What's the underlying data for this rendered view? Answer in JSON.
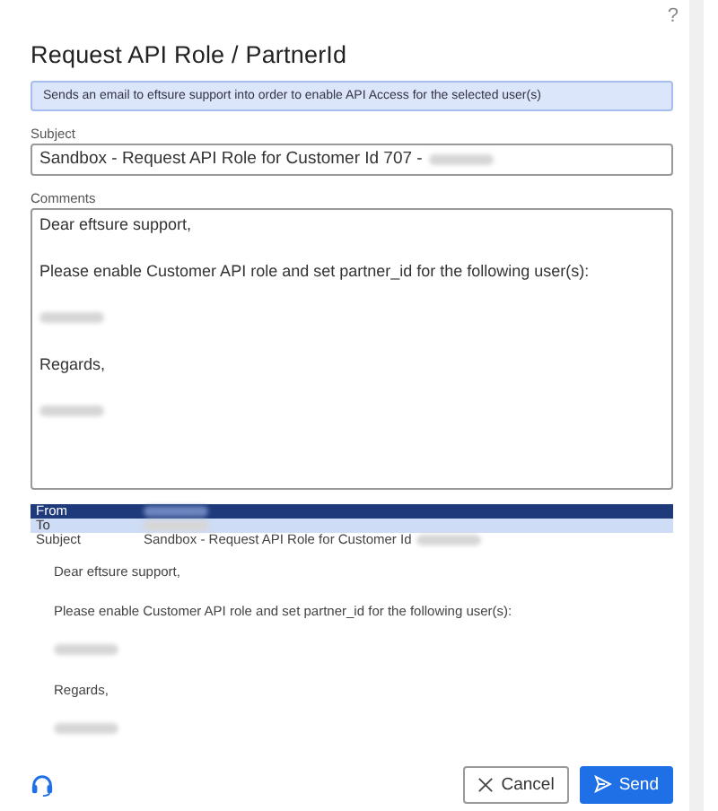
{
  "help": "?",
  "title": "Request API Role / PartnerId",
  "info": "Sends an email to eftsure support into order to enable API Access for the selected user(s)",
  "subject": {
    "label": "Subject",
    "value": "Sandbox - Request API Role for Customer Id 707 -",
    "redacted": true
  },
  "comments": {
    "label": "Comments",
    "lines": [
      {
        "kind": "text",
        "text": "Dear eftsure support,"
      },
      {
        "kind": "text",
        "text": "Please enable Customer API role and set partner_id for the following user(s):"
      },
      {
        "kind": "redacted"
      },
      {
        "kind": "text",
        "text": "Regards,"
      },
      {
        "kind": "redacted"
      }
    ]
  },
  "preview": {
    "headers": [
      {
        "label": "From",
        "redacted": true,
        "selected": true,
        "highlighted": false
      },
      {
        "label": "To",
        "redacted": true,
        "selected": false,
        "highlighted": true
      },
      {
        "label": "Subject",
        "value": "Sandbox - Request API Role for Customer Id",
        "redacted": true,
        "selected": false,
        "highlighted": false
      }
    ],
    "lines": [
      {
        "kind": "text",
        "text": "Dear eftsure support,"
      },
      {
        "kind": "text",
        "text": "Please enable Customer API role and set partner_id for the following user(s):"
      },
      {
        "kind": "redacted"
      },
      {
        "kind": "text",
        "text": "Regards,"
      },
      {
        "kind": "redacted"
      }
    ]
  },
  "buttons": [
    {
      "kind": "cancel",
      "label": "Cancel"
    },
    {
      "kind": "send",
      "label": "Send"
    }
  ]
}
